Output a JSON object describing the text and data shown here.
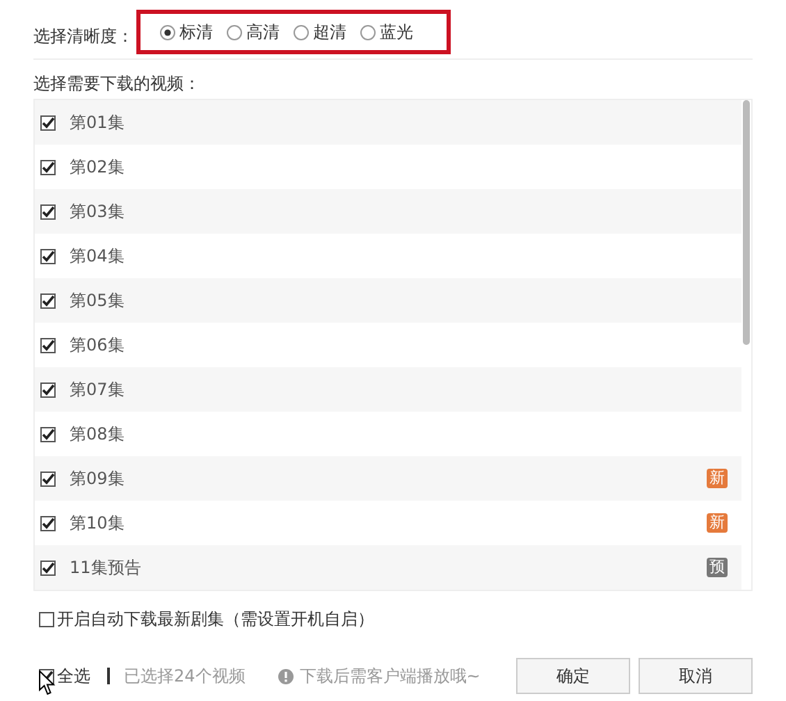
{
  "quality": {
    "label": "选择清晰度：",
    "options": [
      {
        "label": "标清",
        "selected": true
      },
      {
        "label": "高清",
        "selected": false
      },
      {
        "label": "超清",
        "selected": false
      },
      {
        "label": "蓝光",
        "selected": false
      }
    ]
  },
  "episodes": {
    "label": "选择需要下载的视频：",
    "items": [
      {
        "title": "第01集",
        "checked": true
      },
      {
        "title": "第02集",
        "checked": true
      },
      {
        "title": "第03集",
        "checked": true
      },
      {
        "title": "第04集",
        "checked": true
      },
      {
        "title": "第05集",
        "checked": true
      },
      {
        "title": "第06集",
        "checked": true
      },
      {
        "title": "第07集",
        "checked": true
      },
      {
        "title": "第08集",
        "checked": true
      },
      {
        "title": "第09集",
        "checked": true,
        "badge": {
          "text": "新",
          "kind": "new"
        }
      },
      {
        "title": "第10集",
        "checked": true,
        "badge": {
          "text": "新",
          "kind": "new"
        }
      },
      {
        "title": "11集预告",
        "checked": true,
        "badge": {
          "text": "预",
          "kind": "preview"
        }
      }
    ]
  },
  "auto_download": {
    "label": "开启自动下载最新剧集（需设置开机自启）",
    "checked": false
  },
  "footer": {
    "select_all": {
      "label": "全选",
      "checked": true
    },
    "count": "已选择24个视频",
    "notice": "下载后需客户端播放哦~",
    "buttons": [
      "确定",
      "取消"
    ]
  }
}
